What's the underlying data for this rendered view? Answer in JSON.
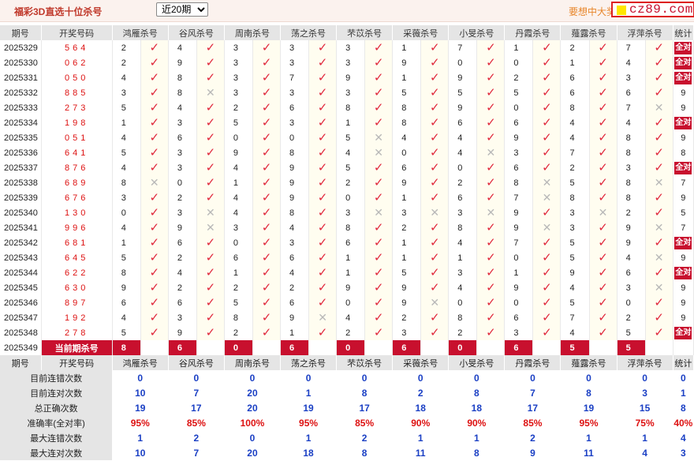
{
  "app_title": "福彩3D直选十位杀号",
  "range_select": {
    "value": "近20期",
    "options": [
      "近20期"
    ]
  },
  "promo_text": "要想中大奖",
  "logo_text": "cz89.com",
  "columns": [
    "期号",
    "开奖号码",
    "鸿雁杀号",
    "谷风杀号",
    "周南杀号",
    "荡之杀号",
    "芣苡杀号",
    "采薇杀号",
    "小旻杀号",
    "丹霞杀号",
    "薤露杀号",
    "浮萍杀号",
    "统计"
  ],
  "rows": [
    {
      "period": "2025329",
      "draw": "564",
      "kills": [
        {
          "n": "2",
          "ok": true
        },
        {
          "n": "4",
          "ok": true
        },
        {
          "n": "3",
          "ok": true
        },
        {
          "n": "3",
          "ok": true
        },
        {
          "n": "3",
          "ok": true
        },
        {
          "n": "1",
          "ok": true
        },
        {
          "n": "7",
          "ok": true
        },
        {
          "n": "1",
          "ok": true
        },
        {
          "n": "2",
          "ok": true
        },
        {
          "n": "7",
          "ok": true
        }
      ],
      "stat": "全对"
    },
    {
      "period": "2025330",
      "draw": "062",
      "kills": [
        {
          "n": "2",
          "ok": true
        },
        {
          "n": "9",
          "ok": true
        },
        {
          "n": "3",
          "ok": true
        },
        {
          "n": "3",
          "ok": true
        },
        {
          "n": "3",
          "ok": true
        },
        {
          "n": "9",
          "ok": true
        },
        {
          "n": "0",
          "ok": true
        },
        {
          "n": "0",
          "ok": true
        },
        {
          "n": "1",
          "ok": true
        },
        {
          "n": "4",
          "ok": true
        }
      ],
      "stat": "全对"
    },
    {
      "period": "2025331",
      "draw": "050",
      "kills": [
        {
          "n": "4",
          "ok": true
        },
        {
          "n": "8",
          "ok": true
        },
        {
          "n": "3",
          "ok": true
        },
        {
          "n": "7",
          "ok": true
        },
        {
          "n": "9",
          "ok": true
        },
        {
          "n": "1",
          "ok": true
        },
        {
          "n": "9",
          "ok": true
        },
        {
          "n": "2",
          "ok": true
        },
        {
          "n": "6",
          "ok": true
        },
        {
          "n": "3",
          "ok": true
        }
      ],
      "stat": "全对"
    },
    {
      "period": "2025332",
      "draw": "885",
      "kills": [
        {
          "n": "3",
          "ok": true
        },
        {
          "n": "8",
          "ok": false
        },
        {
          "n": "3",
          "ok": true
        },
        {
          "n": "3",
          "ok": true
        },
        {
          "n": "3",
          "ok": true
        },
        {
          "n": "5",
          "ok": true
        },
        {
          "n": "5",
          "ok": true
        },
        {
          "n": "5",
          "ok": true
        },
        {
          "n": "6",
          "ok": true
        },
        {
          "n": "6",
          "ok": true
        }
      ],
      "stat": "9"
    },
    {
      "period": "2025333",
      "draw": "273",
      "kills": [
        {
          "n": "5",
          "ok": true
        },
        {
          "n": "4",
          "ok": true
        },
        {
          "n": "2",
          "ok": true
        },
        {
          "n": "6",
          "ok": true
        },
        {
          "n": "8",
          "ok": true
        },
        {
          "n": "8",
          "ok": true
        },
        {
          "n": "9",
          "ok": true
        },
        {
          "n": "0",
          "ok": true
        },
        {
          "n": "8",
          "ok": true
        },
        {
          "n": "7",
          "ok": false
        }
      ],
      "stat": "9"
    },
    {
      "period": "2025334",
      "draw": "198",
      "kills": [
        {
          "n": "1",
          "ok": true
        },
        {
          "n": "3",
          "ok": true
        },
        {
          "n": "5",
          "ok": true
        },
        {
          "n": "3",
          "ok": true
        },
        {
          "n": "1",
          "ok": true
        },
        {
          "n": "8",
          "ok": true
        },
        {
          "n": "6",
          "ok": true
        },
        {
          "n": "6",
          "ok": true
        },
        {
          "n": "4",
          "ok": true
        },
        {
          "n": "4",
          "ok": true
        }
      ],
      "stat": "全对"
    },
    {
      "period": "2025335",
      "draw": "051",
      "kills": [
        {
          "n": "4",
          "ok": true
        },
        {
          "n": "6",
          "ok": true
        },
        {
          "n": "0",
          "ok": true
        },
        {
          "n": "0",
          "ok": true
        },
        {
          "n": "5",
          "ok": false
        },
        {
          "n": "4",
          "ok": true
        },
        {
          "n": "4",
          "ok": true
        },
        {
          "n": "9",
          "ok": true
        },
        {
          "n": "4",
          "ok": true
        },
        {
          "n": "8",
          "ok": true
        }
      ],
      "stat": "9"
    },
    {
      "period": "2025336",
      "draw": "641",
      "kills": [
        {
          "n": "5",
          "ok": true
        },
        {
          "n": "3",
          "ok": true
        },
        {
          "n": "9",
          "ok": true
        },
        {
          "n": "8",
          "ok": true
        },
        {
          "n": "4",
          "ok": false
        },
        {
          "n": "0",
          "ok": true
        },
        {
          "n": "4",
          "ok": false
        },
        {
          "n": "3",
          "ok": true
        },
        {
          "n": "7",
          "ok": true
        },
        {
          "n": "8",
          "ok": true
        }
      ],
      "stat": "8"
    },
    {
      "period": "2025337",
      "draw": "876",
      "kills": [
        {
          "n": "4",
          "ok": true
        },
        {
          "n": "3",
          "ok": true
        },
        {
          "n": "4",
          "ok": true
        },
        {
          "n": "9",
          "ok": true
        },
        {
          "n": "5",
          "ok": true
        },
        {
          "n": "6",
          "ok": true
        },
        {
          "n": "0",
          "ok": true
        },
        {
          "n": "6",
          "ok": true
        },
        {
          "n": "2",
          "ok": true
        },
        {
          "n": "3",
          "ok": true
        }
      ],
      "stat": "全对"
    },
    {
      "period": "2025338",
      "draw": "689",
      "kills": [
        {
          "n": "8",
          "ok": false
        },
        {
          "n": "0",
          "ok": true
        },
        {
          "n": "1",
          "ok": true
        },
        {
          "n": "9",
          "ok": true
        },
        {
          "n": "2",
          "ok": true
        },
        {
          "n": "9",
          "ok": true
        },
        {
          "n": "2",
          "ok": true
        },
        {
          "n": "8",
          "ok": false
        },
        {
          "n": "5",
          "ok": true
        },
        {
          "n": "8",
          "ok": false
        }
      ],
      "stat": "7"
    },
    {
      "period": "2025339",
      "draw": "676",
      "kills": [
        {
          "n": "3",
          "ok": true
        },
        {
          "n": "2",
          "ok": true
        },
        {
          "n": "4",
          "ok": true
        },
        {
          "n": "9",
          "ok": true
        },
        {
          "n": "0",
          "ok": true
        },
        {
          "n": "1",
          "ok": true
        },
        {
          "n": "6",
          "ok": true
        },
        {
          "n": "7",
          "ok": false
        },
        {
          "n": "8",
          "ok": true
        },
        {
          "n": "8",
          "ok": true
        }
      ],
      "stat": "9"
    },
    {
      "period": "2025340",
      "draw": "130",
      "kills": [
        {
          "n": "0",
          "ok": true
        },
        {
          "n": "3",
          "ok": false
        },
        {
          "n": "4",
          "ok": true
        },
        {
          "n": "8",
          "ok": true
        },
        {
          "n": "3",
          "ok": false
        },
        {
          "n": "3",
          "ok": false
        },
        {
          "n": "3",
          "ok": false
        },
        {
          "n": "9",
          "ok": true
        },
        {
          "n": "3",
          "ok": false
        },
        {
          "n": "2",
          "ok": true
        }
      ],
      "stat": "5"
    },
    {
      "period": "2025341",
      "draw": "996",
      "kills": [
        {
          "n": "4",
          "ok": true
        },
        {
          "n": "9",
          "ok": false
        },
        {
          "n": "3",
          "ok": true
        },
        {
          "n": "4",
          "ok": true
        },
        {
          "n": "8",
          "ok": true
        },
        {
          "n": "2",
          "ok": true
        },
        {
          "n": "8",
          "ok": true
        },
        {
          "n": "9",
          "ok": false
        },
        {
          "n": "3",
          "ok": true
        },
        {
          "n": "9",
          "ok": false
        }
      ],
      "stat": "7"
    },
    {
      "period": "2025342",
      "draw": "681",
      "kills": [
        {
          "n": "1",
          "ok": true
        },
        {
          "n": "6",
          "ok": true
        },
        {
          "n": "0",
          "ok": true
        },
        {
          "n": "3",
          "ok": true
        },
        {
          "n": "6",
          "ok": true
        },
        {
          "n": "1",
          "ok": true
        },
        {
          "n": "4",
          "ok": true
        },
        {
          "n": "7",
          "ok": true
        },
        {
          "n": "5",
          "ok": true
        },
        {
          "n": "9",
          "ok": true
        }
      ],
      "stat": "全对"
    },
    {
      "period": "2025343",
      "draw": "645",
      "kills": [
        {
          "n": "5",
          "ok": true
        },
        {
          "n": "2",
          "ok": true
        },
        {
          "n": "6",
          "ok": true
        },
        {
          "n": "6",
          "ok": true
        },
        {
          "n": "1",
          "ok": true
        },
        {
          "n": "1",
          "ok": true
        },
        {
          "n": "1",
          "ok": true
        },
        {
          "n": "0",
          "ok": true
        },
        {
          "n": "5",
          "ok": true
        },
        {
          "n": "4",
          "ok": false
        }
      ],
      "stat": "9"
    },
    {
      "period": "2025344",
      "draw": "622",
      "kills": [
        {
          "n": "8",
          "ok": true
        },
        {
          "n": "4",
          "ok": true
        },
        {
          "n": "1",
          "ok": true
        },
        {
          "n": "4",
          "ok": true
        },
        {
          "n": "1",
          "ok": true
        },
        {
          "n": "5",
          "ok": true
        },
        {
          "n": "3",
          "ok": true
        },
        {
          "n": "1",
          "ok": true
        },
        {
          "n": "9",
          "ok": true
        },
        {
          "n": "6",
          "ok": true
        }
      ],
      "stat": "全对"
    },
    {
      "period": "2025345",
      "draw": "630",
      "kills": [
        {
          "n": "9",
          "ok": true
        },
        {
          "n": "2",
          "ok": true
        },
        {
          "n": "2",
          "ok": true
        },
        {
          "n": "2",
          "ok": true
        },
        {
          "n": "9",
          "ok": true
        },
        {
          "n": "9",
          "ok": true
        },
        {
          "n": "4",
          "ok": true
        },
        {
          "n": "9",
          "ok": true
        },
        {
          "n": "4",
          "ok": true
        },
        {
          "n": "3",
          "ok": false
        }
      ],
      "stat": "9"
    },
    {
      "period": "2025346",
      "draw": "897",
      "kills": [
        {
          "n": "6",
          "ok": true
        },
        {
          "n": "6",
          "ok": true
        },
        {
          "n": "5",
          "ok": true
        },
        {
          "n": "6",
          "ok": true
        },
        {
          "n": "0",
          "ok": true
        },
        {
          "n": "9",
          "ok": false
        },
        {
          "n": "0",
          "ok": true
        },
        {
          "n": "0",
          "ok": true
        },
        {
          "n": "5",
          "ok": true
        },
        {
          "n": "0",
          "ok": true
        }
      ],
      "stat": "9"
    },
    {
      "period": "2025347",
      "draw": "192",
      "kills": [
        {
          "n": "4",
          "ok": true
        },
        {
          "n": "3",
          "ok": true
        },
        {
          "n": "8",
          "ok": true
        },
        {
          "n": "9",
          "ok": false
        },
        {
          "n": "4",
          "ok": true
        },
        {
          "n": "2",
          "ok": true
        },
        {
          "n": "8",
          "ok": true
        },
        {
          "n": "6",
          "ok": true
        },
        {
          "n": "7",
          "ok": true
        },
        {
          "n": "2",
          "ok": true
        }
      ],
      "stat": "9"
    },
    {
      "period": "2025348",
      "draw": "278",
      "kills": [
        {
          "n": "5",
          "ok": true
        },
        {
          "n": "9",
          "ok": true
        },
        {
          "n": "2",
          "ok": true
        },
        {
          "n": "1",
          "ok": true
        },
        {
          "n": "2",
          "ok": true
        },
        {
          "n": "3",
          "ok": true
        },
        {
          "n": "2",
          "ok": true
        },
        {
          "n": "3",
          "ok": true
        },
        {
          "n": "4",
          "ok": true
        },
        {
          "n": "5",
          "ok": true
        }
      ],
      "stat": "全对"
    }
  ],
  "current": {
    "period": "2025349",
    "label": "当前期杀号",
    "kills": [
      "8",
      "6",
      "0",
      "6",
      "0",
      "6",
      "0",
      "6",
      "5",
      "5"
    ]
  },
  "summary": [
    {
      "label": "目前连错次数",
      "values": [
        "0",
        "0",
        "0",
        "0",
        "0",
        "0",
        "0",
        "0",
        "0",
        "0",
        "0"
      ],
      "type": "num"
    },
    {
      "label": "目前连对次数",
      "values": [
        "10",
        "7",
        "20",
        "1",
        "8",
        "2",
        "8",
        "7",
        "8",
        "3",
        "1"
      ],
      "type": "num"
    },
    {
      "label": "总正确次数",
      "values": [
        "19",
        "17",
        "20",
        "19",
        "17",
        "18",
        "18",
        "17",
        "19",
        "15",
        "8"
      ],
      "type": "num"
    },
    {
      "label": "准确率(全对率)",
      "values": [
        "95%",
        "85%",
        "100%",
        "95%",
        "85%",
        "90%",
        "90%",
        "85%",
        "95%",
        "75%",
        "40%"
      ],
      "type": "pct"
    },
    {
      "label": "最大连错次数",
      "values": [
        "1",
        "2",
        "0",
        "1",
        "2",
        "1",
        "1",
        "2",
        "1",
        "1",
        "4"
      ],
      "type": "num"
    },
    {
      "label": "最大连对次数",
      "values": [
        "10",
        "7",
        "20",
        "18",
        "8",
        "11",
        "8",
        "9",
        "11",
        "4",
        "3"
      ],
      "type": "num"
    }
  ],
  "icons": {
    "ok": "check-icon",
    "bad": "cross-icon"
  },
  "colors": {
    "accent": "#c8102e",
    "value_blue": "#1a3fc4",
    "header_gray": "#e5e5e5"
  }
}
